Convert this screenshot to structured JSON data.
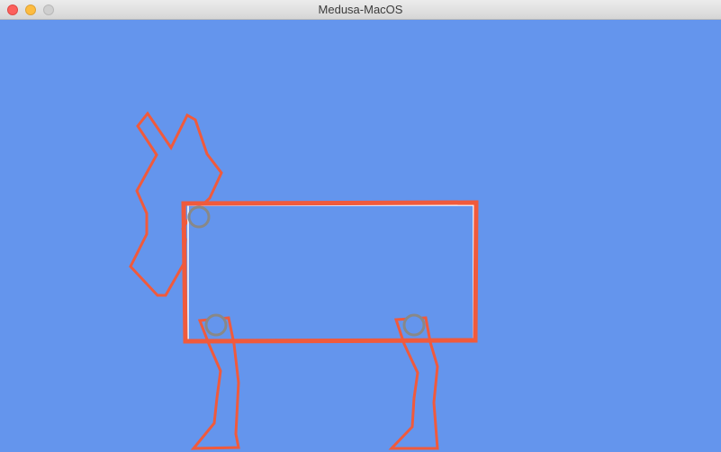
{
  "window": {
    "title": "Medusa-MacOS"
  },
  "colors": {
    "canvas_background": "#6495ED",
    "shape_stroke": "#F05A3C",
    "joint_outer": "#888888",
    "joint_inner": "#6495ED",
    "highlight": "#FFFFFF"
  },
  "icons": {
    "close": "close-icon",
    "minimize": "minimize-icon",
    "zoom": "zoom-icon"
  }
}
